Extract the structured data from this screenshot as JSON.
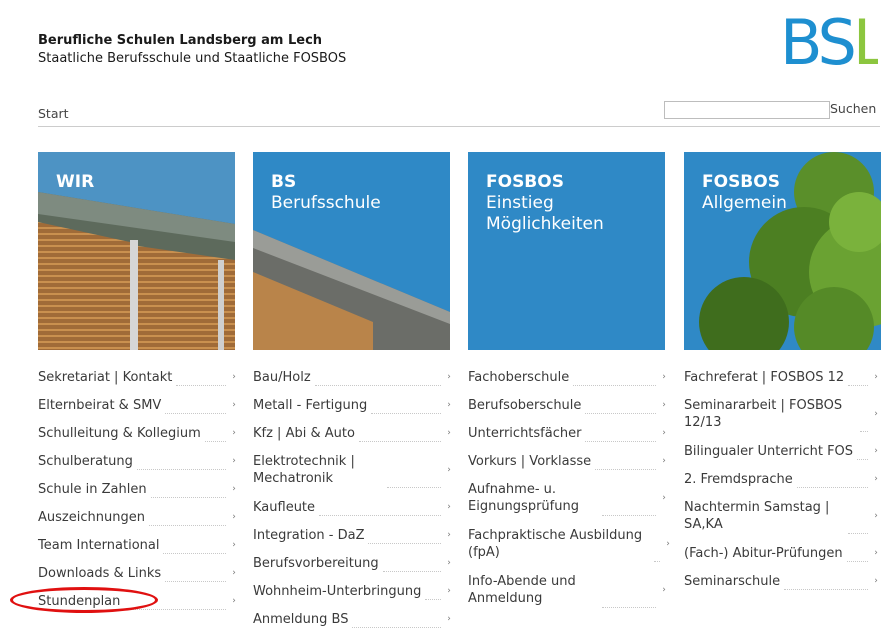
{
  "header": {
    "title": "Berufliche Schulen Landsberg am Lech",
    "subtitle": "Staatliche Berufsschule und Staatliche FOSBOS",
    "logo_text": "BSL"
  },
  "nav": {
    "breadcrumb": "Start",
    "search_value": "",
    "search_label": "Suchen"
  },
  "tiles": [
    {
      "title": "WIR",
      "subtitle": ""
    },
    {
      "title": "BS",
      "subtitle": "Berufsschule"
    },
    {
      "title": "FOSBOS",
      "subtitle": "Einstieg Möglichkeiten"
    },
    {
      "title": "FOSBOS",
      "subtitle": "Allgemein"
    }
  ],
  "menus": [
    [
      "Sekretariat | Kontakt",
      "Elternbeirat & SMV",
      "Schulleitung & Kollegium",
      "Schulberatung",
      "Schule in Zahlen",
      "Auszeichnungen",
      "Team International",
      "Downloads & Links",
      "Stundenplan"
    ],
    [
      "Bau/Holz",
      "Metall - Fertigung",
      "Kfz | Abi & Auto",
      "Elektrotechnik | Mechatronik",
      "Kaufleute",
      "Integration - DaZ",
      "Berufsvorbereitung",
      "Wohnheim-Unterbringung",
      "Anmeldung BS"
    ],
    [
      "Fachoberschule",
      "Berufsoberschule",
      "Unterrichtsfächer",
      "Vorkurs | Vorklasse",
      "Aufnahme- u. Eignungsprüfung",
      "Fachpraktische Ausbildung (fpA)",
      "Info-Abende und Anmeldung"
    ],
    [
      "Fachreferat | FOSBOS 12",
      "Seminararbeit | FOSBOS 12/13",
      "Bilingualer Unterricht FOS",
      "2. Fremdsprache",
      "Nachtermin Samstag | SA,KA",
      "(Fach-) Abitur-Prüfungen",
      "Seminarschule"
    ]
  ],
  "colors": {
    "accent_blue": "#2f89c6",
    "logo_blue": "#1e8fd0",
    "logo_green": "#8cc63f",
    "highlight": "#e01010"
  },
  "icons": {
    "menu_arrow": "›"
  }
}
